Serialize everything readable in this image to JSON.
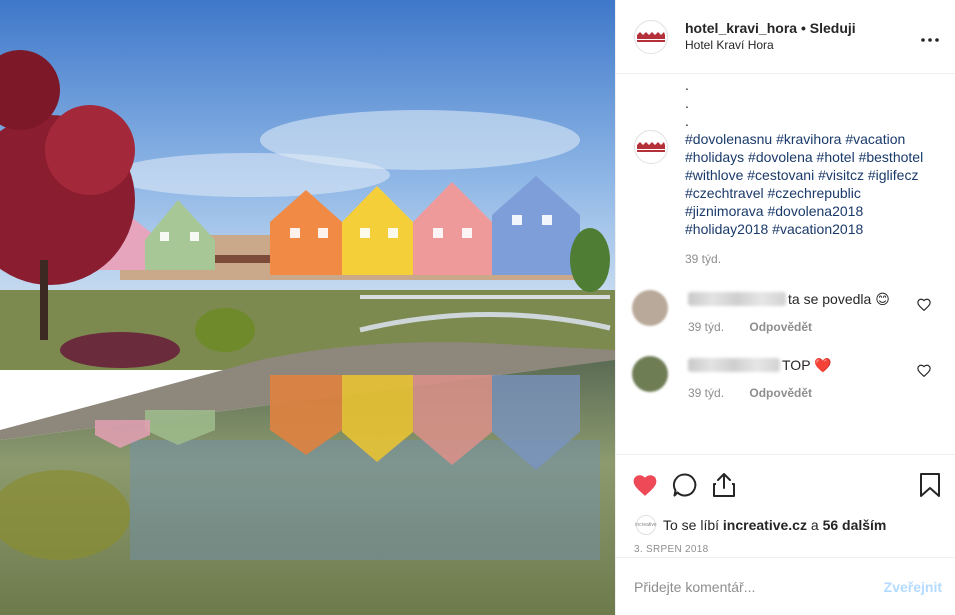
{
  "post": {
    "username": "hotel_kravi_hora",
    "separator": " • ",
    "follow_label": "Sleduji",
    "location": "Hotel Kraví Hora",
    "more_icon": "more-horizontal-icon",
    "logo_text": "HOTEL KRAVÍ HORA"
  },
  "caption": {
    "dots": [
      ".",
      ".",
      "."
    ],
    "hashtags": "#dovolenasnu #kravihora #vacation #holidays #dovolena #hotel #besthotel #withlove #cestovani #visitcz #iglifecz #czechtravel #czechrepublic #jiznimorava #dovolena2018 #holiday2018 #vacation2018",
    "time": "39 týd."
  },
  "comments": [
    {
      "text": "ta se povedla",
      "emoji": "😊",
      "time": "39 týd.",
      "reply": "Odpovědět",
      "avatar_color": "#b9a99a"
    },
    {
      "text": "TOP",
      "emoji": "❤️",
      "time": "39 týd.",
      "reply": "Odpovědět",
      "avatar_color": "#6f7d55"
    }
  ],
  "actions": {
    "like_color": "#ed4956",
    "icons": [
      "heart-icon",
      "comment-icon",
      "share-icon",
      "bookmark-icon"
    ]
  },
  "likes": {
    "prefix": "To se líbí",
    "user": "increative.cz",
    "mid": "a",
    "count": "56 dalším"
  },
  "date": "3. SRPEN 2018",
  "add_comment": {
    "placeholder": "Přidejte komentář...",
    "post_label": "Zveřejnit"
  }
}
